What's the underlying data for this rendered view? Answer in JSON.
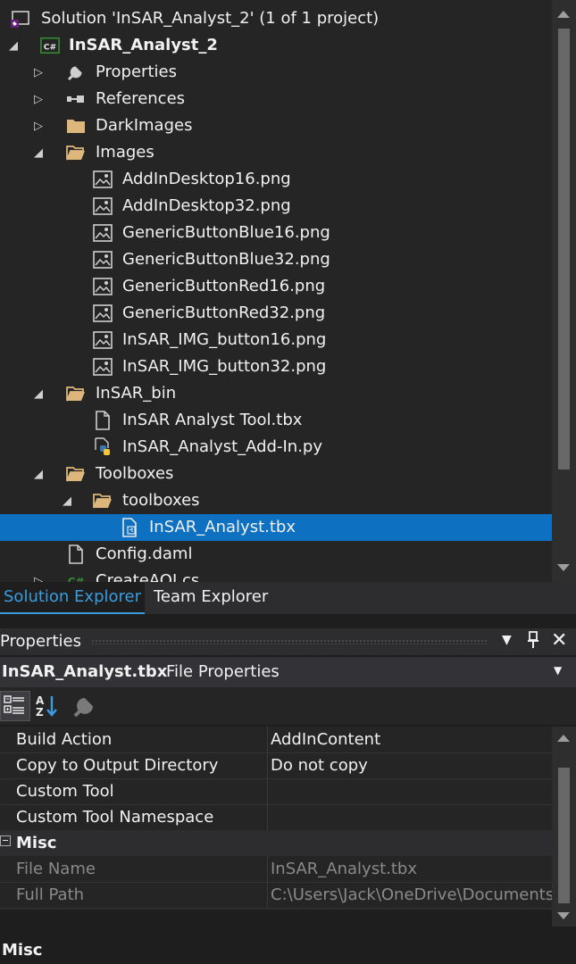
{
  "solution_explorer": {
    "solution_label": "Solution 'InSAR_Analyst_2' (1 of 1 project)",
    "project_badge": "C#",
    "project_name": "InSAR_Analyst_2",
    "items": [
      {
        "label": "Properties"
      },
      {
        "label": "References"
      },
      {
        "label": "DarkImages"
      },
      {
        "label": "Images"
      },
      {
        "label": "AddInDesktop16.png"
      },
      {
        "label": "AddInDesktop32.png"
      },
      {
        "label": "GenericButtonBlue16.png"
      },
      {
        "label": "GenericButtonBlue32.png"
      },
      {
        "label": "GenericButtonRed16.png"
      },
      {
        "label": "GenericButtonRed32.png"
      },
      {
        "label": "InSAR_IMG_button16.png"
      },
      {
        "label": "InSAR_IMG_button32.png"
      },
      {
        "label": "InSAR_bin"
      },
      {
        "label": "InSAR Analyst Tool.tbx"
      },
      {
        "label": "InSAR_Analyst_Add-In.py"
      },
      {
        "label": "Toolboxes"
      },
      {
        "label": "toolboxes"
      },
      {
        "label": "InSAR_Analyst.tbx"
      },
      {
        "label": "Config.daml"
      },
      {
        "label": "CreateAOI.cs"
      }
    ],
    "selected_item": "InSAR_Analyst.tbx"
  },
  "tabs": [
    {
      "label": "Solution Explorer",
      "active": true
    },
    {
      "label": "Team Explorer",
      "active": false
    }
  ],
  "properties_panel": {
    "title": "Properties",
    "object_name": "InSAR_Analyst.tbx",
    "object_type": "File Properties",
    "rows": [
      {
        "name": "Build Action",
        "value": "AddInContent"
      },
      {
        "name": "Copy to Output Directory",
        "value": "Do not copy"
      },
      {
        "name": "Custom Tool",
        "value": ""
      },
      {
        "name": "Custom Tool Namespace",
        "value": ""
      }
    ],
    "category": "Misc",
    "misc_rows": [
      {
        "name": "File Name",
        "value": "InSAR_Analyst.tbx"
      },
      {
        "name": "Full Path",
        "value": "C:\\Users\\Jack\\OneDrive\\Documents"
      }
    ],
    "description_title": "Misc"
  },
  "colors": {
    "background": "#1e1e1e",
    "selection": "#0e70c0",
    "active_tab": "#3a9de0",
    "folder": "#dcb67a",
    "project_badge": "#368832"
  },
  "icons": {
    "solution": "visual-studio-solution-icon",
    "project": "csharp-project-icon",
    "properties": "wrench-icon",
    "references": "references-icon",
    "folder": "folder-icon",
    "image": "image-file-icon",
    "file": "file-icon",
    "python": "python-file-icon",
    "toolbox": "toolbox-file-icon",
    "categorized": "categorized-view-icon",
    "alphabetical": "alphabetical-sort-icon",
    "property_pages": "property-pages-icon"
  }
}
